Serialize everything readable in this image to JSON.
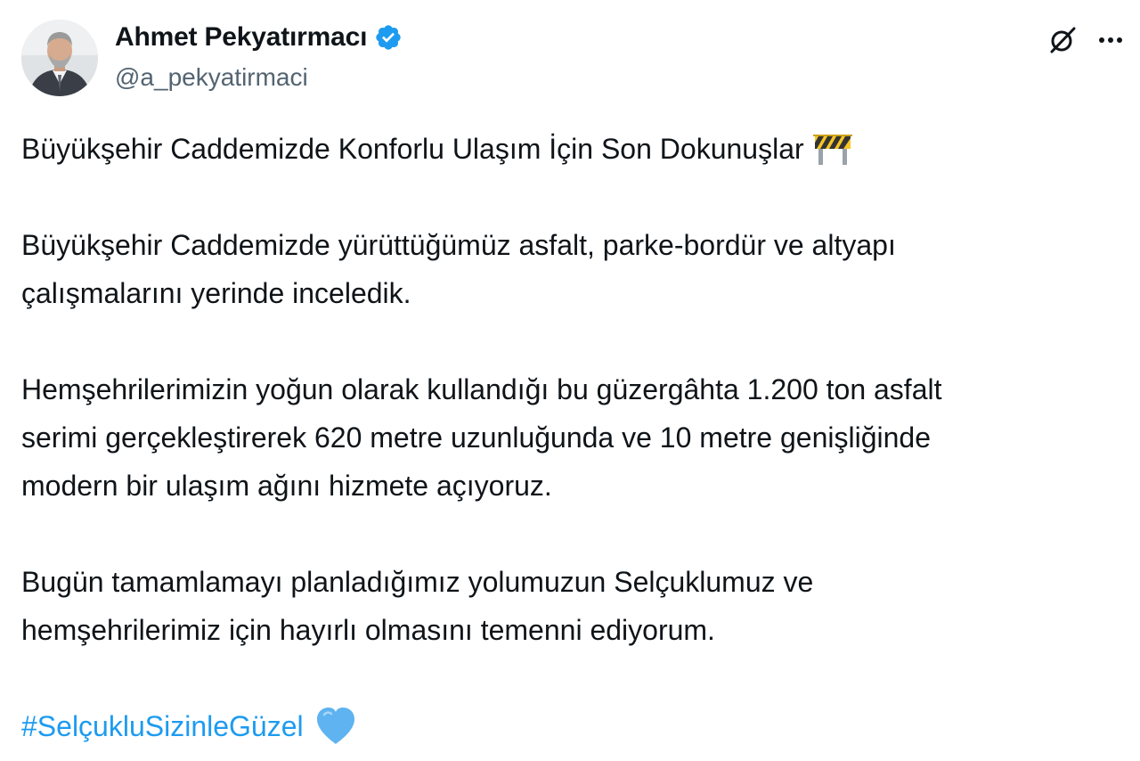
{
  "author": {
    "display_name": "Ahmet Pekyatırmacı",
    "handle": "@a_pekyatirmaci",
    "verified": true,
    "avatar_icon": "avatar-photo"
  },
  "actions": {
    "grok_icon": "grok-icon",
    "more_icon": "more-dots-icon"
  },
  "tweet": {
    "line_title": "Büyükşehir Caddemizde Konforlu Ulaşım İçin Son Dokunuşlar",
    "title_emoji": "construction-barrier-emoji",
    "para2_line1": "Büyükşehir Caddemizde yürüttüğümüz asfalt, parke-bordür ve altyapı",
    "para2_line2": "çalışmalarını yerinde inceledik.",
    "para3_line1": "Hemşehrilerimizin yoğun olarak kullandığı bu güzergâhta 1.200 ton asfalt",
    "para3_line2": "serimi gerçekleştirerek 620 metre uzunluğunda ve 10 metre genişliğinde",
    "para3_line3": "modern bir ulaşım ağını hizmete açıyoruz.",
    "para4_line1": "Bugün tamamlamayı planladığımız yolumuzun Selçuklumuz ve",
    "para4_line2": "hemşehrilerimiz için hayırlı olmasını temenni ediyorum.",
    "hashtag": "#SelçukluSizinleGüzel",
    "hashtag_emoji": "blue-heart-emoji"
  },
  "colors": {
    "text": "#0f1419",
    "secondary": "#536471",
    "accent": "#1d9bf0",
    "heart": "#5eb3f0"
  }
}
